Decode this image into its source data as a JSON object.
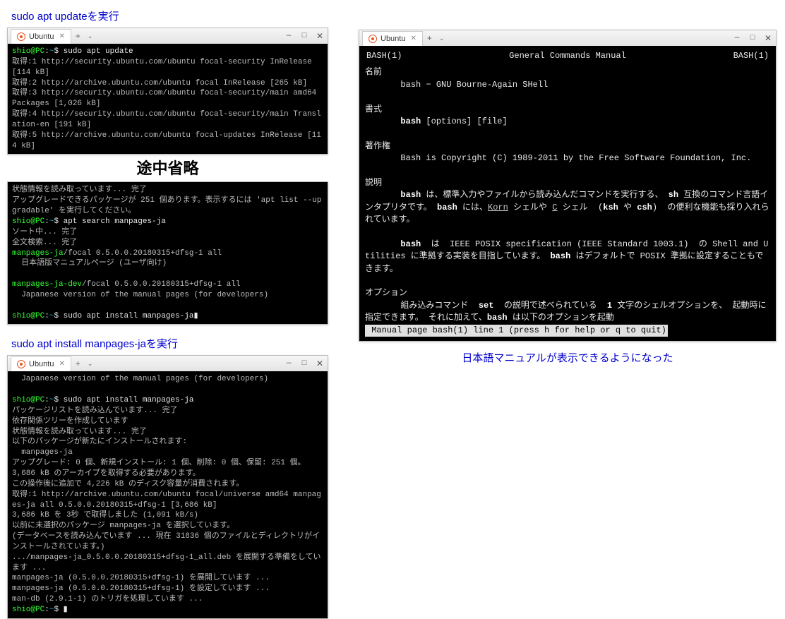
{
  "captions": {
    "c1": "sudo apt updateを実行",
    "abbrev": "途中省略",
    "c2": "sudo apt install manpages-jaを実行",
    "c3": "日本語マニュアルが表示できるようになった"
  },
  "titlebar": {
    "tab_label": "Ubuntu",
    "plus": "+",
    "chev": "⌄",
    "min": "—",
    "max": "□",
    "close": "✕"
  },
  "prompt": {
    "user": "shio",
    "at": "@",
    "host": "PC",
    "sep": ":",
    "path": "~",
    "sigil": "$ "
  },
  "term1": {
    "cmd": "sudo apt update",
    "l1": "取得:1 http://security.ubuntu.com/ubuntu focal-security InRelease [114 kB]",
    "l2": "取得:2 http://archive.ubuntu.com/ubuntu focal InRelease [265 kB]",
    "l3": "取得:3 http://security.ubuntu.com/ubuntu focal-security/main amd64 Packages [1,026 kB]",
    "l4": "取得:4 http://security.ubuntu.com/ubuntu focal-security/main Translation-en [191 kB]",
    "l5": "取得:5 http://archive.ubuntu.com/ubuntu focal-updates InRelease [114 kB]"
  },
  "term2": {
    "l1": "状態情報を読み取っています... 完了",
    "l2": "アップグレードできるパッケージが 251 個あります。表示するには 'apt list --upgradable' を実行してください。",
    "cmd1": "apt search manpages-ja",
    "l3": "ソート中... 完了",
    "l4": "全文検索... 完了",
    "pkg1": "manpages-ja",
    "pkg1v": "/focal 0.5.0.0.20180315+dfsg-1 all",
    "pkg1d": "  日本語版マニュアルページ (ユーザ向け)",
    "pkg2": "manpages-ja-dev",
    "pkg2v": "/focal 0.5.0.0.20180315+dfsg-1 all",
    "pkg2d": "  Japanese version of the manual pages (for developers)",
    "cmd2": "sudo apt install manpages-ja"
  },
  "term3": {
    "l0": "  Japanese version of the manual pages (for developers)",
    "cmd": "sudo apt install manpages-ja",
    "l1": "パッケージリストを読み込んでいます... 完了",
    "l2": "依存関係ツリーを作成しています",
    "l3": "状態情報を読み取っています... 完了",
    "l4": "以下のパッケージが新たにインストールされます:",
    "l5": "  manpages-ja",
    "l6": "アップグレード: 0 個、新規インストール: 1 個、削除: 0 個、保留: 251 個。",
    "l7": "3,686 kB のアーカイブを取得する必要があります。",
    "l8": "この操作後に追加で 4,226 kB のディスク容量が消費されます。",
    "l9": "取得:1 http://archive.ubuntu.com/ubuntu focal/universe amd64 manpages-ja all 0.5.0.0.20180315+dfsg-1 [3,686 kB]",
    "l10": "3,686 kB を 3秒 で取得しました (1,091 kB/s)",
    "l11": "以前に未選択のパッケージ manpages-ja を選択しています。",
    "l12": "(データベースを読み込んでいます ... 現在 31836 個のファイルとディレクトリがインストールされています。)",
    "l13": ".../manpages-ja_0.5.0.0.20180315+dfsg-1_all.deb を展開する準備をしています ...",
    "l14": "manpages-ja (0.5.0.0.20180315+dfsg-1) を展開しています ...",
    "l15": "manpages-ja (0.5.0.0.20180315+dfsg-1) を設定しています ...",
    "l16": "man-db (2.9.1-1) のトリガを処理しています ..."
  },
  "man": {
    "hleft": "BASH(1)",
    "hcenter": "General Commands Manual",
    "hright": "BASH(1)",
    "sec_name": "名前",
    "name_line": "bash − GNU Bourne-Again SHell",
    "sec_syn": "書式",
    "syn_line_b": "bash",
    "syn_line_r": " [options] [file]",
    "sec_copy": "著作権",
    "copy_line": "Bash is Copyright (C) 1989-2011 by the Free Software Foundation, Inc.",
    "sec_desc": "説明",
    "desc_p1a": "bash",
    "desc_p1b": " は、標準入力やファイルから読み込んだコマンドを実行する、 ",
    "desc_p1c": "sh",
    "desc_p1d": " 互換のコマンド言語インタプリタです。 ",
    "desc_p1e": "bash",
    "desc_p1f": " には、",
    "desc_p1g": "Korn",
    "desc_p1h": " シェルや ",
    "desc_p1i": "C",
    "desc_p1j": " シェル  (",
    "desc_p1k": "ksh",
    "desc_p1l": " や ",
    "desc_p1m": "csh",
    "desc_p1n": ")  の便利な機能も採り入れられています。",
    "desc_p2a": "bash",
    "desc_p2b": "  は  IEEE POSIX specification (IEEE Standard 1003.1)  の Shell and Utilities に準拠する実装を目指しています。 ",
    "desc_p2c": "bash",
    "desc_p2d": " はデフォルトで POSIX 準拠に設定することもできます。",
    "sec_opt": "オプション",
    "opt_p1a": "組み込みコマンド  ",
    "opt_p1b": "set",
    "opt_p1c": "  の説明で述べられている  ",
    "opt_p1d": "1",
    "opt_p1e": " 文字のシェルオプションを、 起動時に指定できます。 それに加えて、",
    "opt_p1f": "bash",
    "opt_p1g": " は以下のオプションを起動",
    "status": " Manual page bash(1) line 1 (press h for help or q to quit)"
  }
}
